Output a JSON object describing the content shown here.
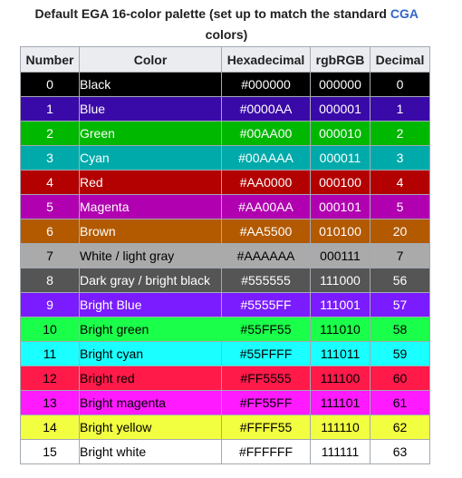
{
  "caption": {
    "prefix": "Default EGA 16-color palette (set up to match the standard ",
    "link": "CGA",
    "suffix": " colors)"
  },
  "headers": [
    "Number",
    "Color",
    "Hexadecimal",
    "rgbRGB",
    "Decimal"
  ],
  "rows": [
    {
      "number": "0",
      "name": "Black",
      "hex": "#000000",
      "rgbRGB": "000000",
      "decimal": "0",
      "bg": "#000000",
      "fg": "dark"
    },
    {
      "number": "1",
      "name": "Blue",
      "hex": "#0000AA",
      "rgbRGB": "000001",
      "decimal": "1",
      "bg": "#3a0aa8",
      "fg": "dark"
    },
    {
      "number": "2",
      "name": "Green",
      "hex": "#00AA00",
      "rgbRGB": "000010",
      "decimal": "2",
      "bg": "#00b800",
      "fg": "dark"
    },
    {
      "number": "3",
      "name": "Cyan",
      "hex": "#00AAAA",
      "rgbRGB": "000011",
      "decimal": "3",
      "bg": "#00aaaa",
      "fg": "dark"
    },
    {
      "number": "4",
      "name": "Red",
      "hex": "#AA0000",
      "rgbRGB": "000100",
      "decimal": "4",
      "bg": "#b30000",
      "fg": "dark"
    },
    {
      "number": "5",
      "name": "Magenta",
      "hex": "#AA00AA",
      "rgbRGB": "000101",
      "decimal": "5",
      "bg": "#b000b0",
      "fg": "dark"
    },
    {
      "number": "6",
      "name": "Brown",
      "hex": "#AA5500",
      "rgbRGB": "010100",
      "decimal": "20",
      "bg": "#b35900",
      "fg": "dark"
    },
    {
      "number": "7",
      "name": "White / light gray",
      "hex": "#AAAAAA",
      "rgbRGB": "000111",
      "decimal": "7",
      "bg": "#aaaaaa",
      "fg": "light"
    },
    {
      "number": "8",
      "name": "Dark gray / bright black",
      "hex": "#555555",
      "rgbRGB": "111000",
      "decimal": "56",
      "bg": "#555555",
      "fg": "dark"
    },
    {
      "number": "9",
      "name": "Bright Blue",
      "hex": "#5555FF",
      "rgbRGB": "111001",
      "decimal": "57",
      "bg": "#7a1cff",
      "fg": "dark"
    },
    {
      "number": "10",
      "name": "Bright green",
      "hex": "#55FF55",
      "rgbRGB": "111010",
      "decimal": "58",
      "bg": "#1aff4a",
      "fg": "light"
    },
    {
      "number": "11",
      "name": "Bright cyan",
      "hex": "#55FFFF",
      "rgbRGB": "111011",
      "decimal": "59",
      "bg": "#1affff",
      "fg": "light"
    },
    {
      "number": "12",
      "name": "Bright red",
      "hex": "#FF5555",
      "rgbRGB": "111100",
      "decimal": "60",
      "bg": "#ff1a4a",
      "fg": "light"
    },
    {
      "number": "13",
      "name": "Bright magenta",
      "hex": "#FF55FF",
      "rgbRGB": "111101",
      "decimal": "61",
      "bg": "#ff1aff",
      "fg": "light"
    },
    {
      "number": "14",
      "name": "Bright yellow",
      "hex": "#FFFF55",
      "rgbRGB": "111110",
      "decimal": "62",
      "bg": "#f2ff40",
      "fg": "light"
    },
    {
      "number": "15",
      "name": "Bright white",
      "hex": "#FFFFFF",
      "rgbRGB": "111111",
      "decimal": "63",
      "bg": "#ffffff",
      "fg": "light"
    }
  ]
}
